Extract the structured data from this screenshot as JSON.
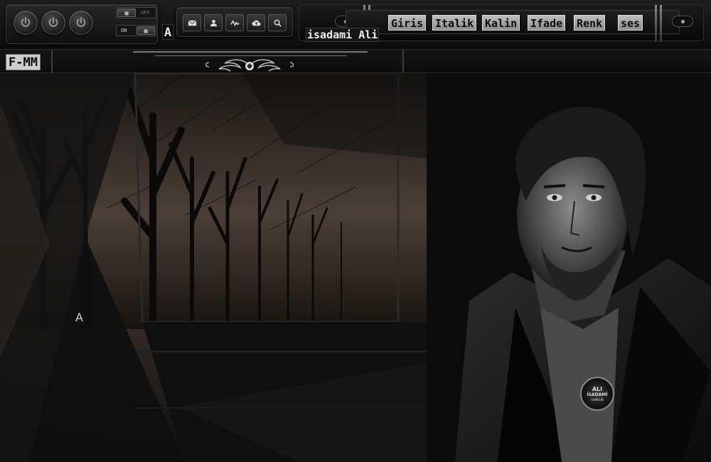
{
  "toolbar": {
    "switch_top_state": "OFF",
    "switch_bottom_state": "ON",
    "font_letter": "A",
    "icons": [
      "mail-icon",
      "user-icon",
      "activity-icon",
      "cloud-upload-icon",
      "search-icon"
    ]
  },
  "brand": {
    "name": "isadami Ali",
    "site_tag": "F-MM"
  },
  "menu": {
    "items": [
      "Giris",
      "Italik",
      "Kalin",
      "Ifade",
      "Renk",
      "ses"
    ]
  },
  "hero": {
    "stray_letter": "A",
    "badge_line1": "ALI",
    "badge_line2": "İSADAMİ",
    "badge_line3": "SAMSUN"
  },
  "colors": {
    "background": "#0b0b0b",
    "chrome": "#1d1d1d",
    "menu_label_bg": "#bdbdbd",
    "accent_sepia": "#4a3f38"
  }
}
